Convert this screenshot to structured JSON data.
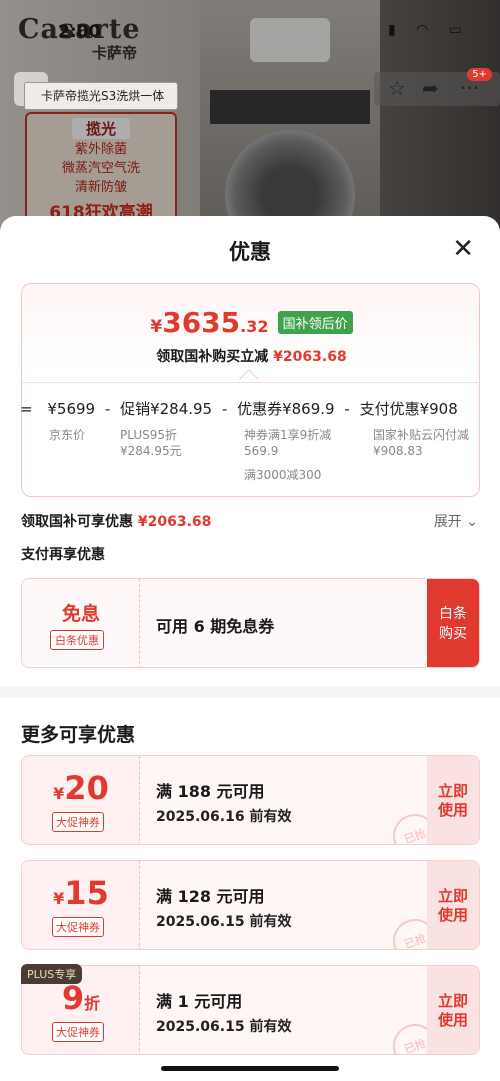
{
  "background": {
    "brand": "Casarte",
    "brand_cn": "卡萨帝",
    "time": "2:00",
    "product_title": "卡萨帝揽光S3洗烘一体",
    "promo": {
      "tag": "揽光",
      "lines": [
        "紫外除菌",
        "微蒸汽空气洗",
        "清新防皱"
      ],
      "headline": "618狂欢高潮"
    },
    "badge": "5+"
  },
  "sheet": {
    "title": "优惠",
    "final_price": {
      "currency": "¥",
      "integer": "3635",
      "decimal": ".32",
      "tag": "国补领后价"
    },
    "subtitle": {
      "text": "领取国补购买立减",
      "amount": "¥2063.68"
    },
    "breakdown": {
      "equals": "=",
      "items": [
        {
          "value": "¥5699",
          "label": "京东价",
          "op": "-"
        },
        {
          "value": "促销¥284.95",
          "label": "PLUS95折",
          "label2": "¥284.95元",
          "op": "-"
        },
        {
          "value": "优惠券¥869.9",
          "label": "神券满1享9折减",
          "label2": "569.9",
          "label3": "满3000减300",
          "op": "-"
        },
        {
          "value": "支付优惠¥908",
          "label": "国家补贴云闪付减",
          "label2": "¥908.83"
        }
      ]
    },
    "national_subsidy": {
      "text": "领取国补可享优惠",
      "amount": "¥2063.68",
      "expand": "展开"
    },
    "pay_title": "支付再享优惠",
    "pay_card": {
      "title": "免息",
      "tag": "白条优惠",
      "desc": "可用 6 期免息券",
      "button": "白条购买"
    },
    "more_title": "更多可享优惠",
    "coupons": [
      {
        "amount": "20",
        "prefix": "¥",
        "suffix": "",
        "label": "大促神券",
        "condition": "满 188 元可用",
        "expiry": "2025.06.16 前有效",
        "button": "立即使用",
        "stamp": "已抢"
      },
      {
        "amount": "15",
        "prefix": "¥",
        "suffix": "",
        "label": "大促神券",
        "condition": "满 128 元可用",
        "expiry": "2025.06.15 前有效",
        "button": "立即使用",
        "stamp": "已抢"
      },
      {
        "amount": "9",
        "prefix": "",
        "suffix": "折",
        "label": "大促神券",
        "condition": "满 1 元可用",
        "expiry": "2025.06.15 前有效",
        "button": "立即使用",
        "stamp": "已抢",
        "plus_tag": "PLUS专享"
      }
    ]
  },
  "colors": {
    "accent": "#e03a2e",
    "green_tag": "#3fa34d"
  }
}
